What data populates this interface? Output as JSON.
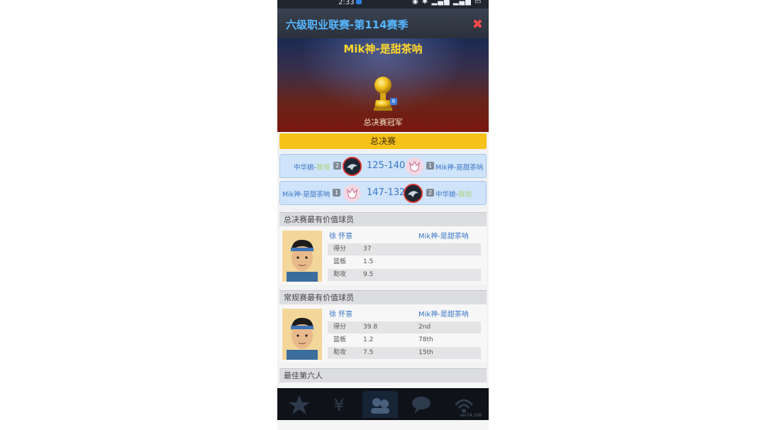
{
  "status_bar": {
    "time": "2:33"
  },
  "header": {
    "title": "六级职业联赛-第114赛季",
    "close_glyph": "✖"
  },
  "hero": {
    "champion_team": "Mik神-是甜茶呐",
    "trophy_badge": "6",
    "caption": "总决赛冠军"
  },
  "finals": {
    "label": "总决赛",
    "games": [
      {
        "home_name": "中华娘-",
        "home_suffix": "我领",
        "home_seed": "2",
        "score": "125-140",
        "away_seed": "1",
        "away_name": "Mik神-是甜茶呐"
      },
      {
        "home_name": "Mik神-是甜茶呐",
        "home_suffix": "",
        "home_seed": "1",
        "score": "147-132",
        "away_seed": "2",
        "away_name": "中华娘-",
        "away_suffix": "我领"
      }
    ]
  },
  "finals_mvp": {
    "heading": "总决赛最有价值球员",
    "player_name": "徐 怀意",
    "team": "Mik神-是甜茶呐",
    "stats": [
      {
        "label": "得分",
        "value": "37",
        "rank": ""
      },
      {
        "label": "篮板",
        "value": "1.5",
        "rank": ""
      },
      {
        "label": "助攻",
        "value": "9.5",
        "rank": ""
      }
    ]
  },
  "regular_mvp": {
    "heading": "常规赛最有价值球员",
    "player_name": "徐 怀意",
    "team": "Mik神-是甜茶呐",
    "stats": [
      {
        "label": "得分",
        "value": "39.8",
        "rank": "2nd"
      },
      {
        "label": "篮板",
        "value": "1.2",
        "rank": "78th"
      },
      {
        "label": "助攻",
        "value": "7.5",
        "rank": "15th"
      }
    ]
  },
  "sixth_man": {
    "heading": "最佳第六人"
  },
  "bottom_nav": {
    "items": [
      "star-icon",
      "yen-icon",
      "team-icon",
      "chat-icon",
      "radio-icon"
    ],
    "version": "ver24.308"
  },
  "colors": {
    "title_blue": "#56b7ff",
    "champion_yellow": "#ffd82b",
    "finals_bar": "#f6c21a",
    "row_blue": "#cfe3fa",
    "link_blue": "#3a78c6",
    "close_red": "#ff4b4b"
  }
}
